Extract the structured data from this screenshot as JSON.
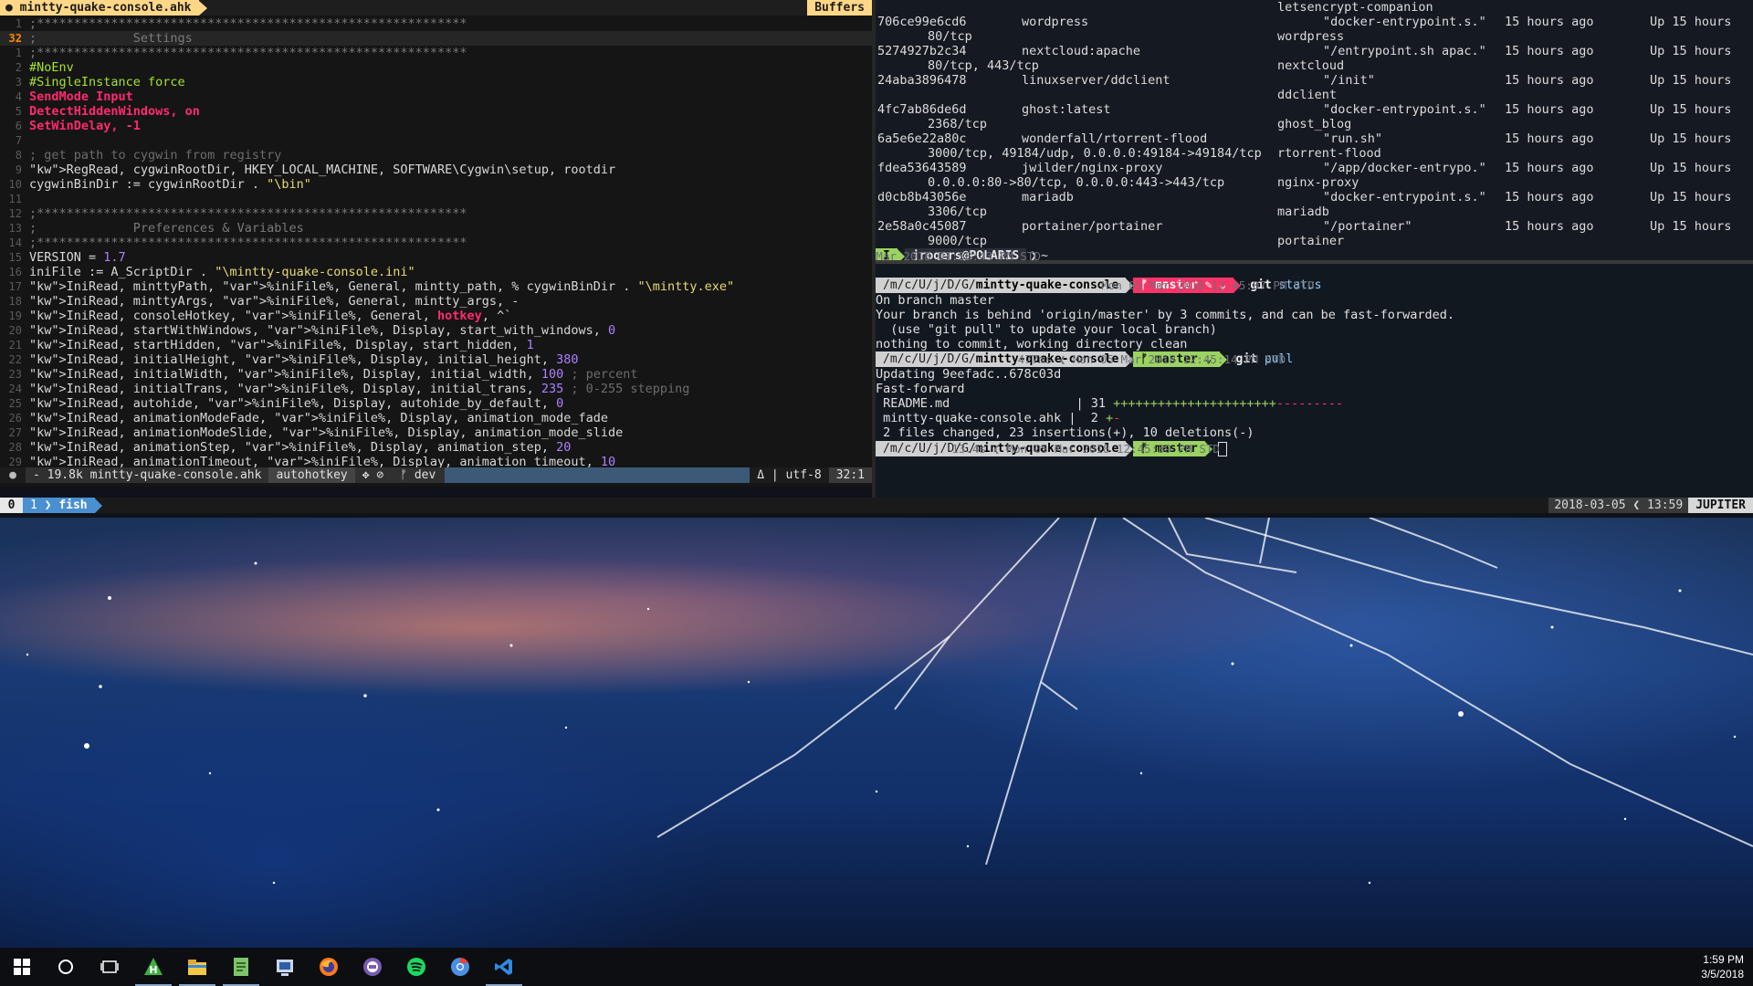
{
  "editor": {
    "tab_icon": "●",
    "tab_title": "mintty-quake-console.ahk",
    "buffers_label": "Buffers",
    "lines": [
      {
        "n": "1",
        "t": ";**********************************************************",
        "c": "cm"
      },
      {
        "n": "32",
        "t": ";             Settings",
        "c": "cm"
      },
      {
        "n": "1",
        "t": ";**********************************************************",
        "c": "cm"
      },
      {
        "n": "2",
        "t": "#NoEnv",
        "c": "dir"
      },
      {
        "n": "3",
        "t": "#SingleInstance force",
        "c": "dir"
      },
      {
        "n": "4",
        "t": "SendMode Input",
        "c": "kw"
      },
      {
        "n": "5",
        "t": "DetectHiddenWindows, on",
        "c": "kw"
      },
      {
        "n": "6",
        "t": "SetWinDelay, -1",
        "c": "kw"
      },
      {
        "n": "7",
        "t": "",
        "c": ""
      },
      {
        "n": "8",
        "t": "; get path to cygwin from registry",
        "c": "cmt"
      },
      {
        "n": "9",
        "t": "RegRead, cygwinRootDir, HKEY_LOCAL_MACHINE, SOFTWARE\\Cygwin\\setup, rootdir",
        "c": ""
      },
      {
        "n": "10",
        "t": "cygwinBinDir := cygwinRootDir . \"\\bin\"",
        "c": ""
      },
      {
        "n": "11",
        "t": "",
        "c": ""
      },
      {
        "n": "12",
        "t": ";**********************************************************",
        "c": "cm"
      },
      {
        "n": "13",
        "t": ";             Preferences & Variables",
        "c": "cm"
      },
      {
        "n": "14",
        "t": ";**********************************************************",
        "c": "cm"
      },
      {
        "n": "15",
        "t": "VERSION = 1.7",
        "c": ""
      },
      {
        "n": "16",
        "t": "iniFile := A_ScriptDir . \"\\mintty-quake-console.ini\"",
        "c": ""
      },
      {
        "n": "17",
        "t": "IniRead, minttyPath, %iniFile%, General, mintty_path, % cygwinBinDir . \"\\mintty.exe\"",
        "c": ""
      },
      {
        "n": "18",
        "t": "IniRead, minttyArgs, %iniFile%, General, mintty_args, -",
        "c": ""
      },
      {
        "n": "19",
        "t": "IniRead, consoleHotkey, %iniFile%, General, hotkey, ^`",
        "c": ""
      },
      {
        "n": "20",
        "t": "IniRead, startWithWindows, %iniFile%, Display, start_with_windows, 0",
        "c": ""
      },
      {
        "n": "21",
        "t": "IniRead, startHidden, %iniFile%, Display, start_hidden, 1",
        "c": ""
      },
      {
        "n": "22",
        "t": "IniRead, initialHeight, %iniFile%, Display, initial_height, 380",
        "c": ""
      },
      {
        "n": "23",
        "t": "IniRead, initialWidth, %iniFile%, Display, initial_width, 100 ; percent",
        "c": ""
      },
      {
        "n": "24",
        "t": "IniRead, initialTrans, %iniFile%, Display, initial_trans, 235 ; 0-255 stepping",
        "c": ""
      },
      {
        "n": "25",
        "t": "IniRead, autohide, %iniFile%, Display, autohide_by_default, 0",
        "c": ""
      },
      {
        "n": "26",
        "t": "IniRead, animationModeFade, %iniFile%, Display, animation_mode_fade",
        "c": ""
      },
      {
        "n": "27",
        "t": "IniRead, animationModeSlide, %iniFile%, Display, animation_mode_slide",
        "c": ""
      },
      {
        "n": "28",
        "t": "IniRead, animationStep, %iniFile%, Display, animation_step, 20",
        "c": ""
      },
      {
        "n": "29",
        "t": "IniRead, animationTimeout, %iniFile%, Display, animation_timeout, 10",
        "c": ""
      }
    ],
    "status": {
      "mode": "●",
      "file": "- 19.8k mintty-quake-console.ahk",
      "filetype": "autohotkey",
      "flags": "✥ ⊘",
      "branch": "ᚠ dev",
      "encoding": "Δ | utf-8",
      "position": "32:1"
    }
  },
  "docker": {
    "header_names": "letsencrypt-companion",
    "rows": [
      {
        "id": "706ce99e6cd6",
        "image": "wordpress",
        "cmd": "\"docker-entrypoint.s.\"",
        "created": "15 hours ago",
        "status": "Up 15 hours",
        "ports": "80/tcp",
        "name": "wordpress"
      },
      {
        "id": "5274927b2c34",
        "image": "nextcloud:apache",
        "cmd": "\"/entrypoint.sh apac.\"",
        "created": "15 hours ago",
        "status": "Up 15 hours",
        "ports": "80/tcp, 443/tcp",
        "name": "nextcloud"
      },
      {
        "id": "24aba3896478",
        "image": "linuxserver/ddclient",
        "cmd": "\"/init\"",
        "created": "15 hours ago",
        "status": "Up 15 hours",
        "ports": "",
        "name": "ddclient"
      },
      {
        "id": "4fc7ab86de6d",
        "image": "ghost:latest",
        "cmd": "\"docker-entrypoint.s.\"",
        "created": "15 hours ago",
        "status": "Up 15 hours",
        "ports": "2368/tcp",
        "name": "ghost_blog"
      },
      {
        "id": "6a5e6e22a80c",
        "image": "wonderfall/rtorrent-flood",
        "cmd": "\"run.sh\"",
        "created": "15 hours ago",
        "status": "Up 15 hours",
        "ports": "3000/tcp, 49184/udp, 0.0.0.0:49184->49184/tcp",
        "name": "rtorrent-flood"
      },
      {
        "id": "fdea53643589",
        "image": "jwilder/nginx-proxy",
        "cmd": "\"/app/docker-entrypo.\"",
        "created": "15 hours ago",
        "status": "Up 15 hours",
        "ports": "0.0.0.0:80->80/tcp, 0.0.0.0:443->443/tcp",
        "name": "nginx-proxy"
      },
      {
        "id": "d0cb8b43056e",
        "image": "mariadb",
        "cmd": "\"docker-entrypoint.s.\"",
        "created": "15 hours ago",
        "status": "Up 15 hours",
        "ports": "3306/tcp",
        "name": "mariadb"
      },
      {
        "id": "2e58a0c45087",
        "image": "portainer/portainer",
        "cmd": "\"/portainer\"",
        "created": "15 hours ago",
        "status": "Up 15 hours",
        "ports": "9000/tcp",
        "name": "portainer"
      }
    ],
    "prompt": {
      "mode": "I",
      "user": "jrogers@POLARIS",
      "dir": "~",
      "time": "143ms ❮ Mon 05 Mar 2018 01:58:43 PM STD"
    }
  },
  "git": {
    "path_prefix": "/m/c/U/j/D/G/",
    "path_repo": "mintty-quake-console",
    "branch_dirty": "ᚠ master ✎ ⌄",
    "branch_clean": "ᚠ master ⌄",
    "branch_plain": "ᚠ master",
    "cmd1": "git",
    "cmd1_arg": "status",
    "time1": "Mon 05 Mar 2018 12:45:07 PM STD",
    "status_lines": [
      "On branch master",
      "Your branch is behind 'origin/master' by 3 commits, and can be fast-forwarded.",
      "  (use \"git pull\" to update your local branch)",
      "nothing to commit, working directory clean"
    ],
    "cmd2": "git",
    "cmd2_arg": "pull",
    "time2": "477ms ❮ Mon 05 Mar 2018 12:45:14 PM STD",
    "pull_lines": [
      "Updating 9eefadc..678c03d",
      "Fast-forward"
    ],
    "diff_files": [
      {
        "name": " README.md                 | 31 ",
        "plus": "++++++++++++++++++++++",
        "minus": "---------"
      },
      {
        "name": " mintty-quake-console.ahk |  2 ",
        "plus": "+",
        "minus": "-"
      }
    ],
    "summary": " 2 files changed, 23 insertions(+), 10 deletions(-)",
    "time3": "13.4s ❮ Mon 05 Mar 2018 12:45:39 PM STD"
  },
  "tmux": {
    "session": "0",
    "window_index": "1",
    "window_name": "fish",
    "date": "2018-03-05 ❮ 13:59",
    "host": "JUPITER"
  },
  "taskbar": {
    "apps": [
      "windows-start-icon",
      "cortana-search-icon",
      "task-view-icon",
      "autohotkey-icon",
      "file-explorer-icon",
      "notepad-icon",
      "app-icon",
      "firefox-icon",
      "app-purple-icon",
      "spotify-icon",
      "chrome-icon",
      "vscode-icon"
    ],
    "time": "1:59 PM",
    "date": "3/5/2018"
  }
}
